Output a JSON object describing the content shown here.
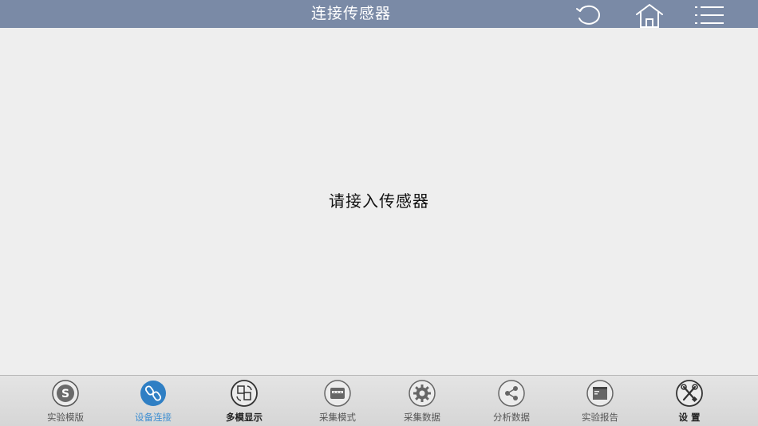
{
  "header": {
    "title": "连接传感器",
    "refresh_icon": "refresh-icon",
    "home_icon": "home-icon",
    "menu_icon": "menu-list-icon",
    "bar_color": "#7a8aa6"
  },
  "main": {
    "prompt": "请接入传感器"
  },
  "bottom_nav": {
    "active_color": "#3f8fd2",
    "items": [
      {
        "label": "实验模版",
        "icon": "s-template-icon"
      },
      {
        "label": "设备连接",
        "icon": "link-icon",
        "active": true
      },
      {
        "label": "多模显示",
        "icon": "multi-display-icon"
      },
      {
        "label": "采集模式",
        "icon": "collect-mode-icon"
      },
      {
        "label": "采集数据",
        "icon": "gear-icon"
      },
      {
        "label": "分析数据",
        "icon": "share-icon"
      },
      {
        "label": "实验报告",
        "icon": "report-icon"
      },
      {
        "label": "设 置",
        "icon": "tools-icon"
      }
    ]
  }
}
